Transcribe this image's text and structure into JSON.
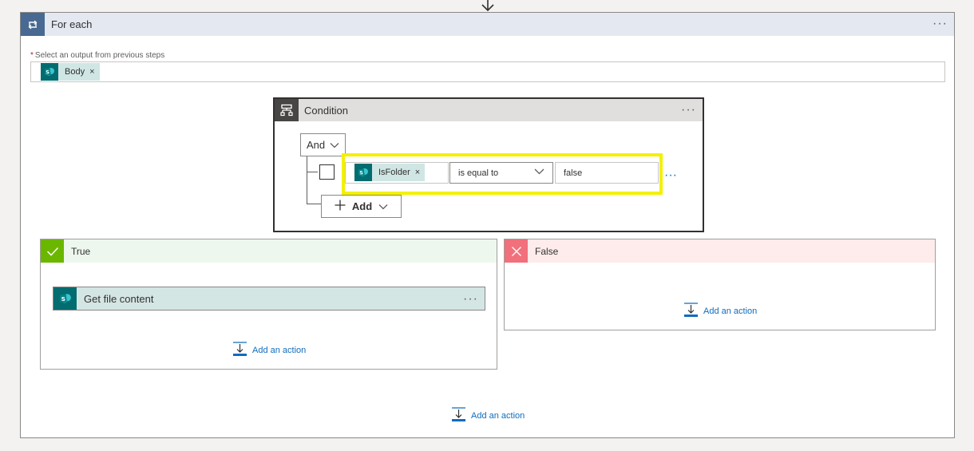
{
  "top_connector": {
    "icon": "arrow-down-icon"
  },
  "foreach": {
    "title": "For each",
    "icon": "loop-icon",
    "more": "···",
    "output_label": "Select an output from previous steps",
    "required_mark": "*",
    "token": {
      "label": "Body",
      "remove": "×",
      "icon": "sharepoint-icon"
    },
    "add_action": "Add an action"
  },
  "condition": {
    "title": "Condition",
    "icon": "condition-icon",
    "more": "···",
    "group_operator": "And",
    "row": {
      "operand1": {
        "label": "IsFolder",
        "remove": "×",
        "icon": "sharepoint-icon"
      },
      "operator": "is equal to",
      "operand2": "false",
      "more": "···"
    },
    "add_label": "Add"
  },
  "true_branch": {
    "title": "True",
    "icon": "checkmark-icon",
    "action": {
      "title": "Get file content",
      "more": "···",
      "icon": "sharepoint-icon"
    },
    "add_action": "Add an action"
  },
  "false_branch": {
    "title": "False",
    "icon": "close-icon",
    "add_action": "Add an action"
  },
  "colors": {
    "foreach_icon_bg": "#486991",
    "sharepoint": "#036c70",
    "true": "#6bb700",
    "false": "#f1707b",
    "highlight": "#f4f000",
    "link": "#0f6cbd"
  }
}
